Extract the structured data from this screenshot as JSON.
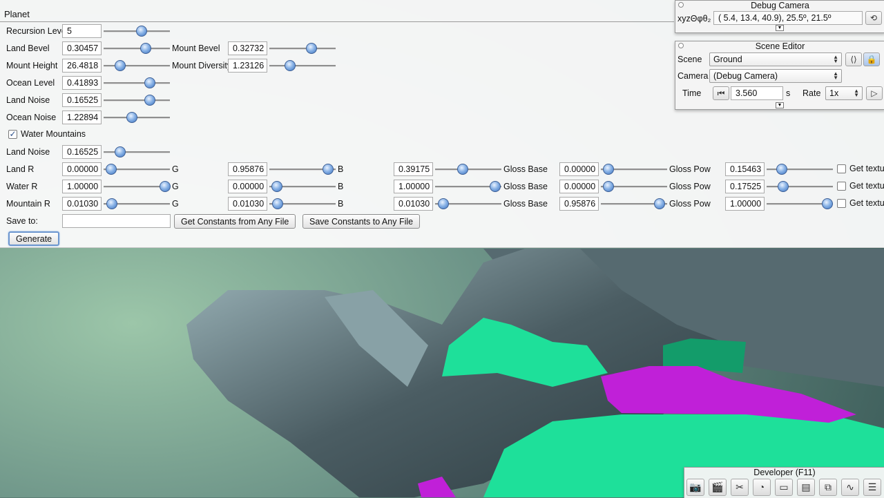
{
  "planet": {
    "title": "Planet",
    "recursion_level": {
      "label": "Recursion Level",
      "value": "5"
    },
    "land_bevel": {
      "label": "Land Bevel",
      "value": "0.30457",
      "slider": 0.62
    },
    "mount_bevel": {
      "label": "Mount Bevel",
      "value": "0.32732",
      "slider": 0.63
    },
    "mount_height": {
      "label": "Mount Height",
      "value": "26.4818",
      "slider": 0.24
    },
    "mount_diversity": {
      "label": "Mount Diversity",
      "value": "1.23126",
      "slider": 0.3
    },
    "ocean_level": {
      "label": "Ocean Level",
      "value": "0.41893",
      "slider": 0.69
    },
    "land_noise": {
      "label": "Land Noise",
      "value": "0.16525",
      "slider": 0.69
    },
    "ocean_noise": {
      "label": "Ocean Noise",
      "value": "1.22894",
      "slider": 0.42
    },
    "water_mountains": {
      "label": "Water Mountains",
      "checked": true
    },
    "land_noise_2": {
      "label": "Land Noise",
      "value": "0.16525",
      "slider": 0.24
    },
    "recursion_slider": 0.56,
    "color_rows": [
      {
        "label": "Land R",
        "r": "0.00000",
        "r_slider": 0.1,
        "g_label": "G",
        "g": "0.95876",
        "g_slider": 0.87,
        "b_label": "B",
        "b": "0.39175",
        "b_slider": 0.41,
        "gloss_base_label": "Gloss Base",
        "gloss_base": "0.00000",
        "gloss_base_slider": 0.1,
        "gloss_pow_label": "Gloss Pow",
        "gloss_pow": "0.15463",
        "gloss_pow_slider": 0.22,
        "tex_label": "Get textu"
      },
      {
        "label": "Water R",
        "r": "1.00000",
        "r_slider": 0.92,
        "g_label": "G",
        "g": "0.00000",
        "g_slider": 0.1,
        "b_label": "B",
        "b": "1.00000",
        "b_slider": 0.9,
        "gloss_base_label": "Gloss Base",
        "gloss_base": "0.00000",
        "gloss_base_slider": 0.1,
        "gloss_pow_label": "Gloss Pow",
        "gloss_pow": "0.17525",
        "gloss_pow_slider": 0.24,
        "tex_label": "Get textu"
      },
      {
        "label": "Mountain R",
        "r": "0.01030",
        "r_slider": 0.11,
        "g_label": "G",
        "g": "0.01030",
        "g_slider": 0.11,
        "b_label": "B",
        "b": "0.01030",
        "b_slider": 0.11,
        "gloss_base_label": "Gloss Base",
        "gloss_base": "0.95876",
        "gloss_base_slider": 0.87,
        "gloss_pow_label": "Gloss Pow",
        "gloss_pow": "1.00000",
        "gloss_pow_slider": 0.91,
        "tex_label": "Get textu"
      }
    ],
    "save_to": {
      "label": "Save to:",
      "value": ""
    },
    "get_constants_label": "Get Constants from Any File",
    "save_constants_label": "Save Constants to Any File",
    "generate_label": "Generate"
  },
  "debug_camera": {
    "title": "Debug Camera",
    "xyz_label": "xyzΘφθ₂",
    "value": "(  5.4,  13.4,  40.9),  25.5º,  21.5º"
  },
  "scene_editor": {
    "title": "Scene Editor",
    "scene_label": "Scene",
    "scene_value": "Ground",
    "camera_label": "Camera",
    "camera_value": "(Debug Camera)",
    "time_label": "Time",
    "time_value": "3.560",
    "time_unit": "s",
    "rate_label": "Rate",
    "rate_value": "1x"
  },
  "developer": {
    "title": "Developer (F11)",
    "icons": [
      "camera-icon",
      "clapperboard-icon",
      "tools-icon",
      "gauge-icon",
      "new-window-icon",
      "console-icon",
      "windows-icon",
      "performance-icon",
      "document-icon"
    ]
  },
  "colors": {
    "sky": "#5b7d74",
    "green_land": "#1ee09a",
    "magenta_water": "#c020d8",
    "rock": "#3e4d52",
    "slider_knob": "#5b8fd6"
  }
}
